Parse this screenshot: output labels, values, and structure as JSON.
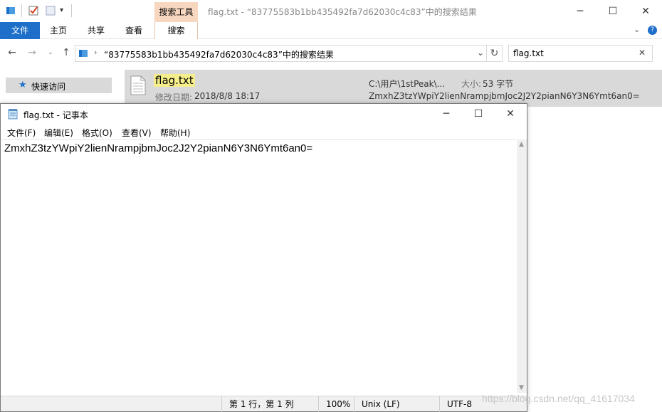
{
  "explorer": {
    "context_tab_label": "搜索工具",
    "title": "flag.txt - “83775583b1bb435492fa7d62030c4c83”中的搜索结果",
    "ribbon_tabs": [
      "文件",
      "主页",
      "共享",
      "查看",
      "搜索"
    ],
    "address_path": "“83775583b1bb435492fa7d62030c4c83”中的搜索结果",
    "search_value": "flag.txt",
    "nav": {
      "quick_access": "快速访问"
    },
    "result": {
      "name": "flag.txt",
      "modified_label": "修改日期:",
      "modified_value": "2018/8/8 18:17",
      "path": "C:\\用户\\1stPeak\\...",
      "size_label": "大小:",
      "size_value": "53 字节",
      "content_preview": "ZmxhZ3tzYWpiY2lienNrampjbmJoc2J2Y2pianN6Y3N6Ymt6an0="
    },
    "icons": [
      "drive-icon",
      "properties-icon",
      "new-folder-icon",
      "customize-qa-icon",
      "minimize-icon",
      "maximize-icon",
      "close-icon",
      "back-icon",
      "forward-icon",
      "recent-icon",
      "up-icon",
      "refresh-icon",
      "clear-search-icon",
      "star-icon",
      "text-file-icon",
      "help-icon"
    ]
  },
  "notepad": {
    "title": "flag.txt - 记事本",
    "menus": [
      "文件(F)",
      "编辑(E)",
      "格式(O)",
      "查看(V)",
      "帮助(H)"
    ],
    "content": "ZmxhZ3tzYWpiY2lienNrampjbmJoc2J2Y2pianN6Y3N6Ymt6an0=",
    "status": {
      "position": "第 1 行，第 1 列",
      "zoom": "100%",
      "line_ending": "Unix (LF)",
      "encoding": "UTF-8"
    }
  },
  "watermark": "https://blog.csdn.net/qq_41617034",
  "colors": {
    "accent": "#1e6fc9",
    "context_tab": "#f8d7c0",
    "selection": "#d9d9d9",
    "highlight": "#ffff99"
  }
}
